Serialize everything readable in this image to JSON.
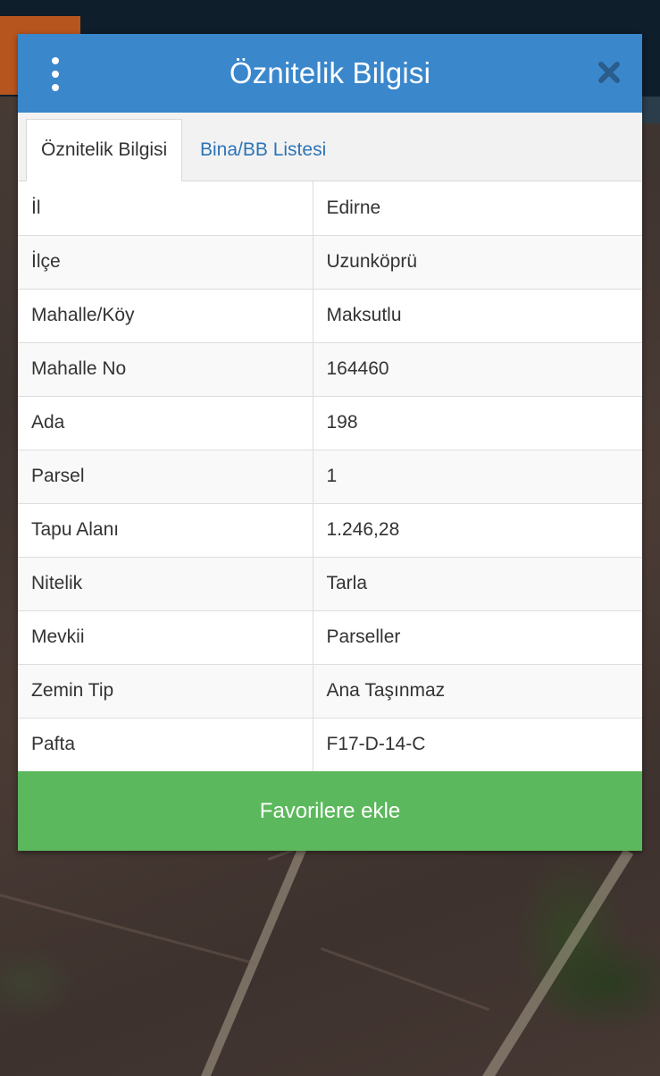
{
  "dialog": {
    "title": "Öznitelik Bilgisi",
    "tabs": [
      {
        "label": "Öznitelik Bilgisi"
      },
      {
        "label": "Bina/BB Listesi"
      }
    ]
  },
  "attributes": [
    {
      "key": "İl",
      "value": "Edirne"
    },
    {
      "key": "İlçe",
      "value": "Uzunköprü"
    },
    {
      "key": "Mahalle/Köy",
      "value": "Maksutlu"
    },
    {
      "key": "Mahalle No",
      "value": "164460"
    },
    {
      "key": "Ada",
      "value": "198"
    },
    {
      "key": "Parsel",
      "value": "1"
    },
    {
      "key": "Tapu Alanı",
      "value": "1.246,28"
    },
    {
      "key": "Nitelik",
      "value": "Tarla"
    },
    {
      "key": "Mevkii",
      "value": "Parseller"
    },
    {
      "key": "Zemin Tip",
      "value": "Ana Taşınmaz"
    },
    {
      "key": "Pafta",
      "value": "F17-D-14-C"
    }
  ],
  "actions": {
    "favorite_label": "Favorilere ekle"
  },
  "colors": {
    "header": "#3a87cc",
    "favorite_button": "#5cb85c",
    "tab_link": "#2d74b8",
    "top_bar": "#0e1e2b",
    "orange_tab": "#b7551f"
  },
  "icons": {
    "menu": "kebab-menu-icon",
    "close": "close-icon"
  }
}
